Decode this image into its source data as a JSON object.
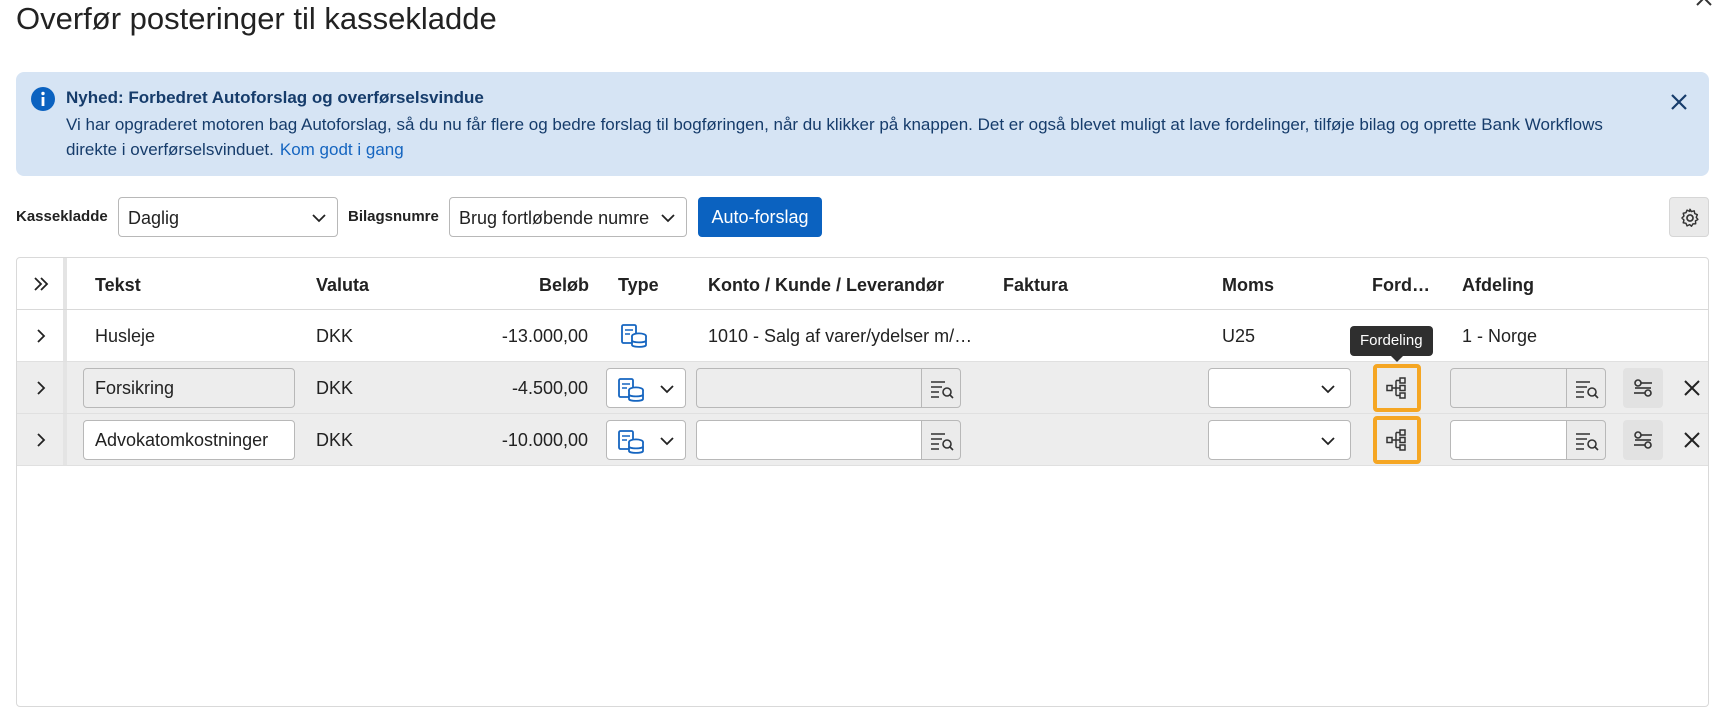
{
  "title": "Overfør posteringer til kassekladde",
  "banner": {
    "title": "Nyhed: Forbedret Autoforslag og overførselsvindue",
    "text": "Vi har opgraderet motoren bag Autoforslag, så du nu får flere og bedre forslag til bogføringen, når du klikker på knappen. Det er også blevet muligt at lave fordelinger, tilføje bilag og oprette Bank Workflows direkte i overførselsvinduet.",
    "link": "Kom godt i gang"
  },
  "toolbar": {
    "kassekladde_label": "Kassekladde",
    "kassekladde_value": "Daglig",
    "bilagsnumre_label": "Bilagsnumre",
    "bilagsnumre_value": "Brug fortløbende numre",
    "auto_label": "Auto-forslag"
  },
  "columns": {
    "tekst": "Tekst",
    "valuta": "Valuta",
    "belob": "Beløb",
    "type": "Type",
    "konto": "Konto / Kunde / Leverandør",
    "faktura": "Faktura",
    "moms": "Moms",
    "fordeling": "Ford…",
    "afdeling": "Afdeling"
  },
  "rows": [
    {
      "tekst": "Husleje",
      "valuta": "DKK",
      "belob": "-13.000,00",
      "konto": "1010 - Salg af varer/ydelser m/…",
      "moms": "U25",
      "afdeling": "1 - Norge"
    },
    {
      "tekst": "Forsikring",
      "valuta": "DKK",
      "belob": "-4.500,00"
    },
    {
      "tekst": "Advokatomkostninger",
      "valuta": "DKK",
      "belob": "-10.000,00"
    }
  ],
  "tooltip": "Fordeling",
  "colors": {
    "accent": "#0b62c0",
    "banner_bg": "#d6e4f4",
    "highlight": "#f5a623"
  }
}
